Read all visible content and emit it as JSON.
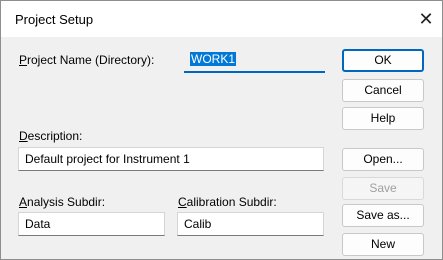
{
  "window": {
    "title": "Project Setup"
  },
  "fields": {
    "project_name": {
      "label_u": "P",
      "label_rest": "roject Name (Directory):",
      "value": "WORK1"
    },
    "description": {
      "label_u": "D",
      "label_rest": "escription:",
      "value": "Default project for Instrument 1"
    },
    "analysis": {
      "label_u": "A",
      "label_rest": "nalysis Subdir:",
      "value": "Data"
    },
    "calibration": {
      "label_u": "C",
      "label_rest": "alibration Subdir:",
      "value": "Calib"
    }
  },
  "buttons": {
    "ok": "OK",
    "cancel": "Cancel",
    "help": "Help",
    "open": "Open...",
    "save": "Save",
    "save_as": "Save as...",
    "new": "New"
  },
  "icons": {
    "close": "close-icon"
  }
}
